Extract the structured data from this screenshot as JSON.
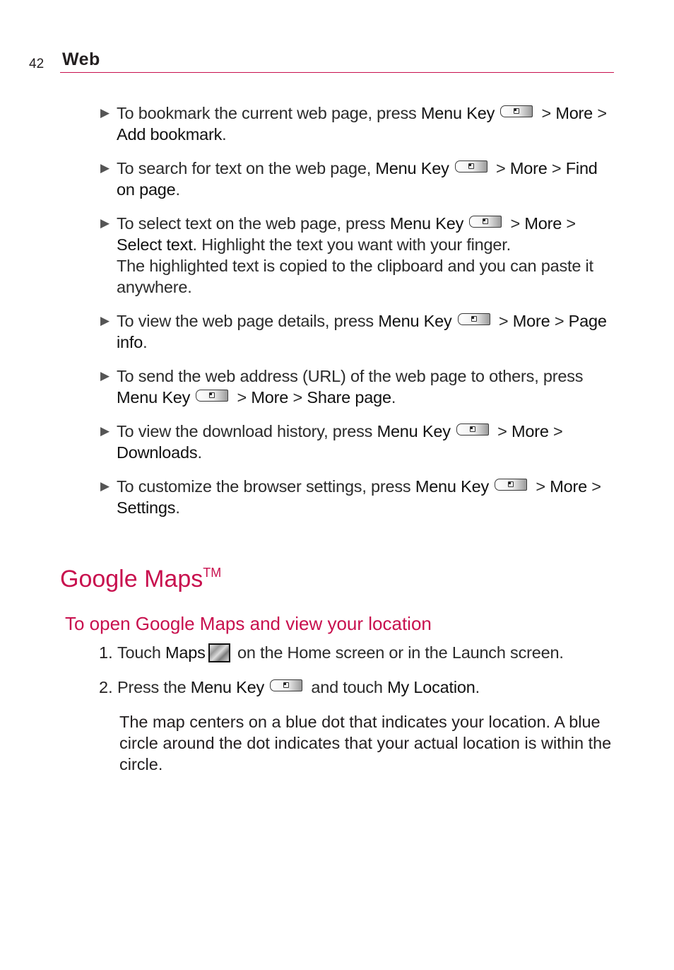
{
  "header": {
    "page_number": "42",
    "section": "Web",
    "accent_color": "#c8104e"
  },
  "bullets": [
    {
      "parts": [
        {
          "t": "To bookmark the current web page, press "
        },
        {
          "b": "Menu Key"
        },
        {
          "icon": "menu-key-icon"
        },
        {
          "t": " > "
        },
        {
          "b": "More"
        },
        {
          "t": " > "
        },
        {
          "b": "Add bookmark"
        },
        {
          "t": "."
        }
      ]
    },
    {
      "parts": [
        {
          "t": "To search for text on the web page, "
        },
        {
          "b": "Menu Key"
        },
        {
          "icon": "menu-key-icon"
        },
        {
          "t": " > "
        },
        {
          "b": "More"
        },
        {
          "t": " > "
        },
        {
          "b": "Find on page"
        },
        {
          "t": "."
        }
      ]
    },
    {
      "parts": [
        {
          "t": "To select text on the web page, press "
        },
        {
          "b": "Menu Key"
        },
        {
          "icon": "menu-key-icon"
        },
        {
          "t": " > "
        },
        {
          "b": "More"
        },
        {
          "t": " > "
        },
        {
          "b": "Select text"
        },
        {
          "t": ". Highlight the text you want with your finger."
        },
        {
          "br": true
        },
        {
          "t": "The highlighted text is copied to the clipboard and you can paste it anywhere."
        }
      ]
    },
    {
      "parts": [
        {
          "t": "To view the web page details, press "
        },
        {
          "b": "Menu Key"
        },
        {
          "icon": "menu-key-icon"
        },
        {
          "t": " > "
        },
        {
          "b": "More"
        },
        {
          "t": " > "
        },
        {
          "b": "Page info"
        },
        {
          "t": "."
        }
      ]
    },
    {
      "parts": [
        {
          "t": "To send the web address (URL) of the web page to others, press "
        },
        {
          "b": "Menu Key"
        },
        {
          "icon": "menu-key-icon"
        },
        {
          "t": " > "
        },
        {
          "b": "More"
        },
        {
          "t": " > "
        },
        {
          "b": "Share page"
        },
        {
          "t": "."
        }
      ]
    },
    {
      "parts": [
        {
          "t": "To view the download history, press "
        },
        {
          "b": "Menu Key"
        },
        {
          "icon": "menu-key-icon"
        },
        {
          "t": " > "
        },
        {
          "b": "More"
        },
        {
          "t": " > "
        },
        {
          "b": "Downloads"
        },
        {
          "t": "."
        }
      ]
    },
    {
      "parts": [
        {
          "t": "To customize the browser settings, press "
        },
        {
          "b": "Menu Key"
        },
        {
          "icon": "menu-key-icon"
        },
        {
          "t": " > "
        },
        {
          "b": "More"
        },
        {
          "t": " > "
        },
        {
          "b": "Settings"
        },
        {
          "t": "."
        }
      ]
    }
  ],
  "google_maps": {
    "title": "Google Maps",
    "trademark": "TM",
    "subtitle": "To open Google Maps and view your location",
    "steps": [
      {
        "num": "1.",
        "parts": [
          {
            "t": "Touch "
          },
          {
            "b": "Maps"
          },
          {
            "icon": "maps-app-icon"
          },
          {
            "t": " on the Home screen or in the Launch screen."
          }
        ]
      },
      {
        "num": "2.",
        "parts": [
          {
            "t": "Press the "
          },
          {
            "b": "Menu Key"
          },
          {
            "icon": "menu-key-icon"
          },
          {
            "t": " and touch "
          },
          {
            "b": "My Location"
          },
          {
            "t": "."
          }
        ]
      }
    ],
    "note": "The map centers on a blue dot that indicates your location. A blue circle around the dot indicates that your actual location is within the circle."
  }
}
